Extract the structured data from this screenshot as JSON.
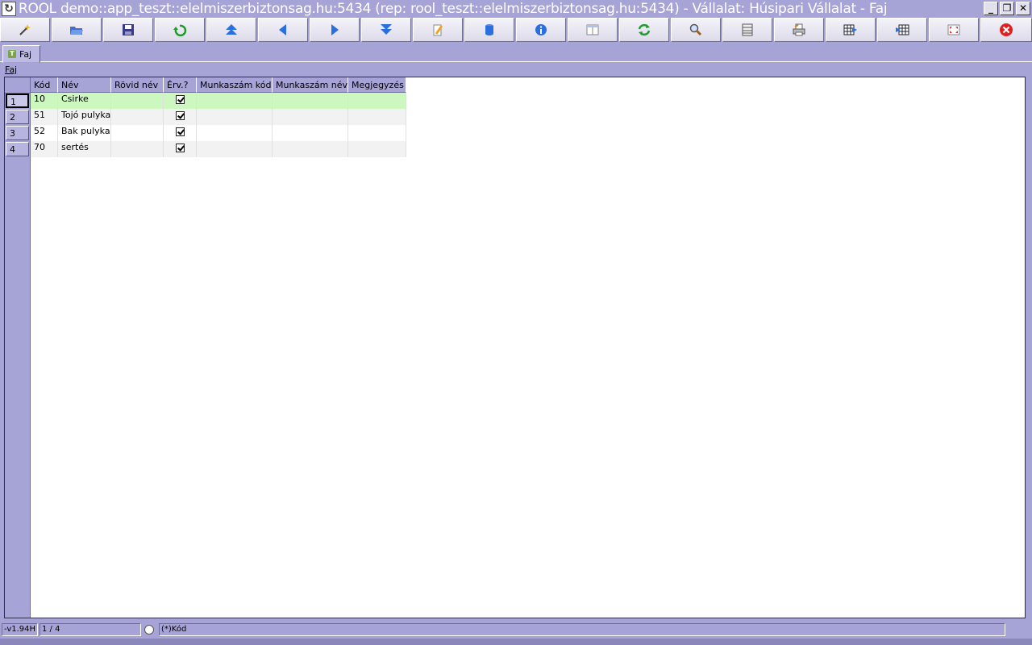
{
  "window": {
    "title": "ROOL demo::app_teszt::elelmiszerbiztonsag.hu:5434 (rep: rool_teszt::elelmiszerbiztonsag.hu:5434) - Vállalat: Húsipari Vállalat - Faj",
    "controls": [
      "_",
      "❐",
      "✕"
    ]
  },
  "toolbar": {
    "buttons": [
      {
        "name": "new",
        "icon": "wand-icon"
      },
      {
        "name": "open",
        "icon": "folder-icon"
      },
      {
        "name": "save",
        "icon": "floppy-icon"
      },
      {
        "name": "undo",
        "icon": "undo-arrow-icon"
      },
      {
        "name": "first",
        "icon": "first-record-icon"
      },
      {
        "name": "prev",
        "icon": "prev-record-icon"
      },
      {
        "name": "next",
        "icon": "next-record-icon"
      },
      {
        "name": "last",
        "icon": "last-record-icon"
      },
      {
        "name": "edit",
        "icon": "pencil-icon"
      },
      {
        "name": "database",
        "icon": "database-icon"
      },
      {
        "name": "info",
        "icon": "info-icon"
      },
      {
        "name": "form-view",
        "icon": "form-view-icon"
      },
      {
        "name": "refresh",
        "icon": "refresh-icon"
      },
      {
        "name": "search",
        "icon": "search-icon"
      },
      {
        "name": "filter",
        "icon": "filter-icon"
      },
      {
        "name": "print",
        "icon": "print-icon"
      },
      {
        "name": "export-grid",
        "icon": "grid-export-icon"
      },
      {
        "name": "import-grid",
        "icon": "grid-import-icon"
      },
      {
        "name": "fit",
        "icon": "fit-window-icon"
      },
      {
        "name": "close",
        "icon": "close-icon"
      }
    ]
  },
  "tabs": [
    {
      "label": "Faj"
    }
  ],
  "group_label": "Faj",
  "grid": {
    "columns": [
      "Kód",
      "Név",
      "Rövid név",
      "Érv.?",
      "Munkaszám kód",
      "Munkaszám név",
      "Megjegyzés"
    ],
    "rows": [
      {
        "num": "1",
        "kod": "10",
        "nev": "Csirke",
        "rovid": "",
        "erv": true,
        "mk": "",
        "mn": "",
        "megj": ""
      },
      {
        "num": "2",
        "kod": "51",
        "nev": "Tojó pulyka",
        "rovid": "",
        "erv": true,
        "mk": "",
        "mn": "",
        "megj": ""
      },
      {
        "num": "3",
        "kod": "52",
        "nev": "Bak pulyka",
        "rovid": "",
        "erv": true,
        "mk": "",
        "mn": "",
        "megj": ""
      },
      {
        "num": "4",
        "kod": "70",
        "nev": "sertés",
        "rovid": "",
        "erv": true,
        "mk": "",
        "mn": "",
        "megj": ""
      }
    ]
  },
  "status": {
    "version": "-v1.94H",
    "position": "1 / 4",
    "sort": "(*)Kód"
  },
  "colors": {
    "chrome": "#a6a3d6",
    "selected_row": "#ccf7bf"
  }
}
